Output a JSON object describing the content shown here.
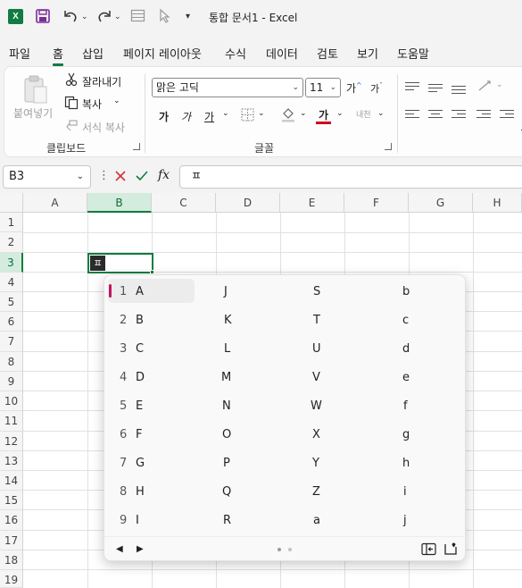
{
  "titlebar": {
    "app_icon": "X",
    "title": "통합 문서1 - Excel"
  },
  "menu": {
    "tabs": [
      "파일",
      "홈",
      "삽입",
      "페이지 레이아웃",
      "수식",
      "데이터",
      "검토",
      "보기",
      "도움말"
    ],
    "active": "홈"
  },
  "ribbon": {
    "clipboard": {
      "paste": "붙여넣기",
      "cut": "잘라내기",
      "copy": "복사",
      "format_painter": "서식 복사",
      "group_label": "클립보드"
    },
    "font": {
      "font_name": "맑은 고딕",
      "font_size": "11",
      "grow": "가",
      "shrink": "가",
      "bold": "가",
      "italic": "가",
      "underline": "가",
      "font_color_glyph": "가",
      "phonetic": "내천",
      "group_label": "글꼴",
      "font_color": "#d0021b"
    }
  },
  "formula_bar": {
    "name_box": "B3",
    "fx": "fx",
    "content": "ㅍ"
  },
  "grid": {
    "columns": [
      "A",
      "B",
      "C",
      "D",
      "E",
      "F",
      "G",
      "H"
    ],
    "rows": [
      "1",
      "2",
      "3",
      "4",
      "5",
      "6",
      "7",
      "8",
      "9",
      "10",
      "11",
      "12",
      "13",
      "14",
      "15",
      "16",
      "17",
      "18",
      "19"
    ],
    "selected_column": "B",
    "selected_row": "3",
    "active_cell_text": "ㅍ",
    "accent": "#107c41"
  },
  "candidates": {
    "col1": [
      {
        "num": "1",
        "ch": "A"
      },
      {
        "num": "2",
        "ch": "B"
      },
      {
        "num": "3",
        "ch": "C"
      },
      {
        "num": "4",
        "ch": "D"
      },
      {
        "num": "5",
        "ch": "E"
      },
      {
        "num": "6",
        "ch": "F"
      },
      {
        "num": "7",
        "ch": "G"
      },
      {
        "num": "8",
        "ch": "H"
      },
      {
        "num": "9",
        "ch": "I"
      }
    ],
    "col2": [
      "J",
      "K",
      "L",
      "M",
      "N",
      "O",
      "P",
      "Q",
      "R"
    ],
    "col3": [
      "S",
      "T",
      "U",
      "V",
      "W",
      "X",
      "Y",
      "Z",
      "a"
    ],
    "col4": [
      "b",
      "c",
      "d",
      "e",
      "f",
      "g",
      "h",
      "i",
      "j"
    ],
    "selected_accent": "#c0175f"
  }
}
